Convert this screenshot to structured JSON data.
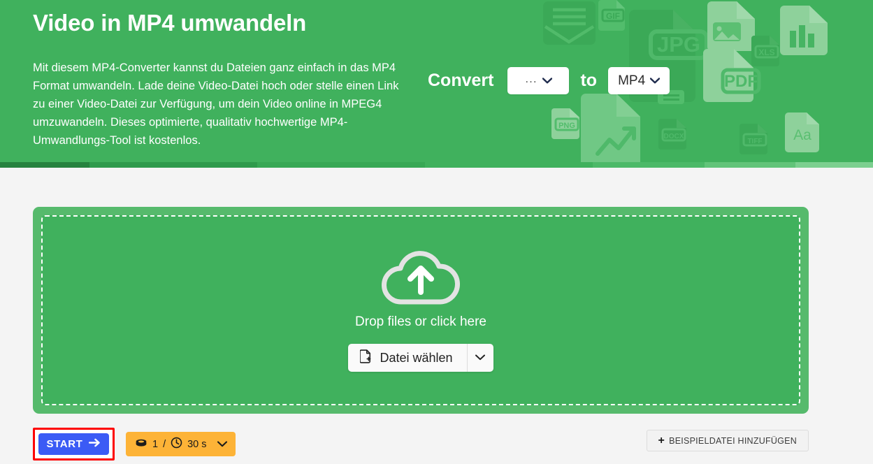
{
  "hero": {
    "title": "Video in MP4 umwandeln",
    "description": "Mit diesem MP4-Converter kannst du Dateien ganz einfach in das MP4 Format umwandeln. Lade deine Video-Datei hoch oder stelle einen Link zu einer Video-Datei zur Verfügung, um dein Video online in MPEG4 umzuwandeln. Dieses optimierte, qualitativ hochwertige MP4-Umwandlungs-Tool ist kostenlos.",
    "background_color": "#40b15d",
    "converter": {
      "convert_label": "Convert",
      "to_label": "to",
      "source_format": "...",
      "target_format": "MP4",
      "source_icon": "chevron-down-icon",
      "target_icon": "chevron-down-icon"
    },
    "background_icons": [
      "envelope-icon",
      "gif-file-icon",
      "jpg-file-icon",
      "image-file-icon",
      "xls-file-icon",
      "bar-chart-file-icon",
      "pdf-file-icon",
      "printer-icon",
      "png-file-icon",
      "line-chart-file-icon",
      "docx-file-icon",
      "tiff-file-icon",
      "aa-text-file-icon"
    ],
    "stripe_colors": [
      "#26823f",
      "#2f9a4c",
      "#38a855",
      "#40b15d",
      "#4cb968",
      "#62c479",
      "#7ccf8f"
    ]
  },
  "dropzone": {
    "upload_icon": "cloud-upload-icon",
    "prompt": "Drop files or click here",
    "choose_button": {
      "icon": "file-add-icon",
      "label": "Datei wählen",
      "caret_icon": "chevron-down-icon"
    },
    "panel_color": "#56ba6c",
    "inner_color": "#40b15d"
  },
  "actionbar": {
    "start": {
      "label": "START",
      "icon": "arrow-right-icon",
      "color": "#3b5bf5",
      "highlight_color": "#fe0000"
    },
    "credits": {
      "coin_icon": "coin-icon",
      "count": "1",
      "separator": "/",
      "clock_icon": "clock-icon",
      "duration": "30 s",
      "caret_icon": "chevron-down-icon",
      "color": "#fdb337"
    },
    "sample": {
      "icon": "plus-icon",
      "label": "BEISPIELDATEI HINZUFÜGEN"
    }
  }
}
